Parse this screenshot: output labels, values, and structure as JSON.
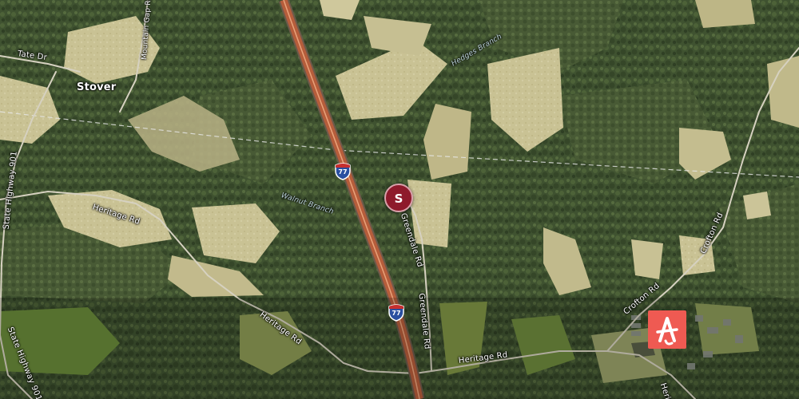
{
  "map": {
    "places": {
      "town": "Stover"
    },
    "roads": {
      "tate_dr": "Tate Dr",
      "mountain_rd": "Mountain Gap Rd",
      "heritage_rd": "Heritage Rd",
      "state_hwy_901": "State Highway 901",
      "greendale_rd": "Greendale Rd",
      "crofton_rd": "Crofton Rd",
      "heritage_rd_partial": "Herit"
    },
    "interstate": {
      "number": "77"
    },
    "water": {
      "branch_1": "Hedges Branch",
      "branch_2": "Walnut Branch"
    },
    "marker": {
      "label": "S",
      "color": "#8e1a2b"
    },
    "logo": {
      "name": "brand-logo-icon",
      "color": "#ef5a52"
    }
  }
}
